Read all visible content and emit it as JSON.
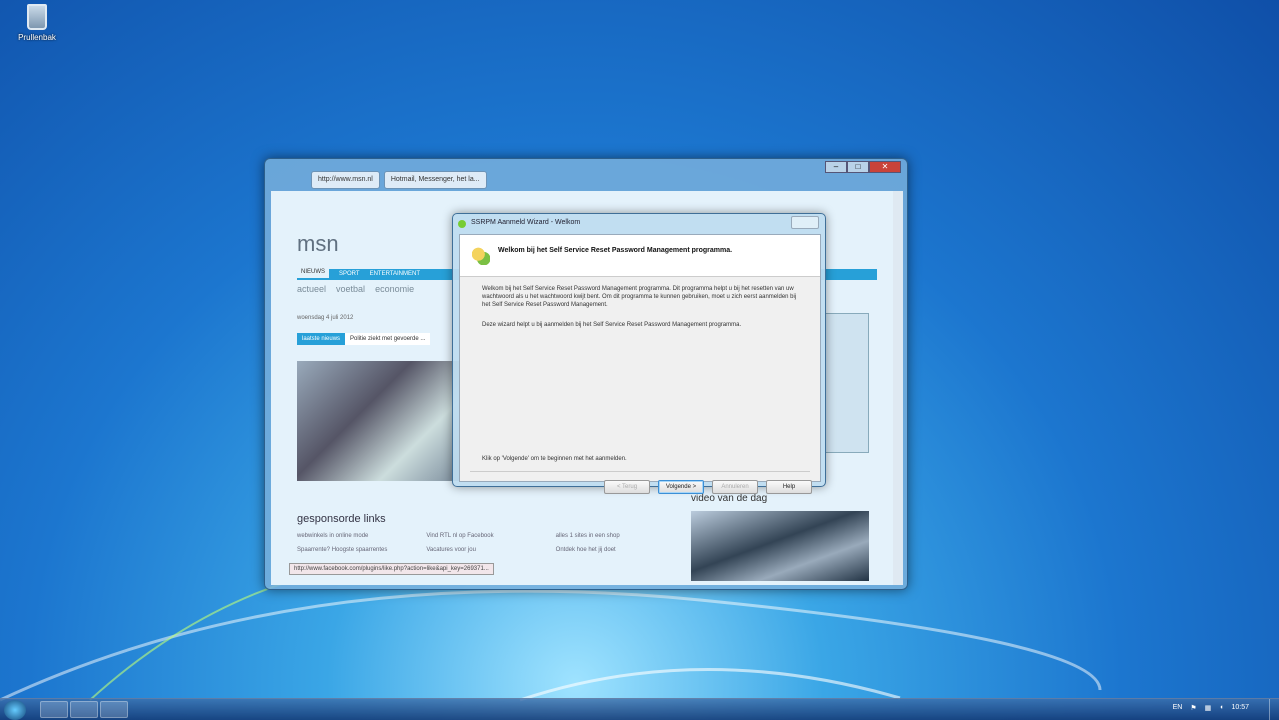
{
  "desktop": {
    "recycle_bin_label": "Prullenbak"
  },
  "browser": {
    "tabs": [
      "http://www.msn.nl",
      "Hotmail, Messenger, het la..."
    ],
    "logo": "msn",
    "nav": [
      "NIEUWS",
      "SPORT",
      "ENTERTAINMENT"
    ],
    "subnav": [
      "actueel",
      "voetbal",
      "economie"
    ],
    "date": "woensdag 4 juli 2012",
    "breaking_label": "laatste nieuws",
    "breaking_text": "Politie ziekt met gevoerde ...",
    "sponsored_heading": "gesponsorde links",
    "links": [
      "webwinkels in online mode",
      "Vind RTL nl op Facebook",
      "alles 1 sites in een shop",
      "Spaarrente? Hoogste spaarrentes",
      "Vacatures voor jou",
      "Ontdek hoe het jij doet"
    ],
    "video_heading": "video van de dag",
    "status_url": "http://www.facebook.com/plugins/like.php?action=like&api_key=269371..."
  },
  "dialog": {
    "title": "SSRPM Aanmeld Wizard - Welkom",
    "heading": "Welkom bij het Self Service Reset Password Management programma.",
    "para1": "Welkom bij het Self Service Reset Password Management programma. Dit programma helpt u bij het resetten van uw wachtwoord als u het wachtwoord kwijt bent. Om dit programma te kunnen gebruiken, moet u zich eerst aanmelden bij het Self Service Reset Password Management.",
    "para2": "Deze wizard helpt u bij aanmelden bij het Self Service Reset Password Management programma.",
    "footer": "Klik op 'Volgende' om te beginnen met het aanmelden.",
    "buttons": {
      "back": "< Terug",
      "next": "Volgende >",
      "cancel": "Annuleren",
      "help": "Help"
    }
  },
  "taskbar": {
    "language": "EN",
    "clock": "10:57"
  }
}
